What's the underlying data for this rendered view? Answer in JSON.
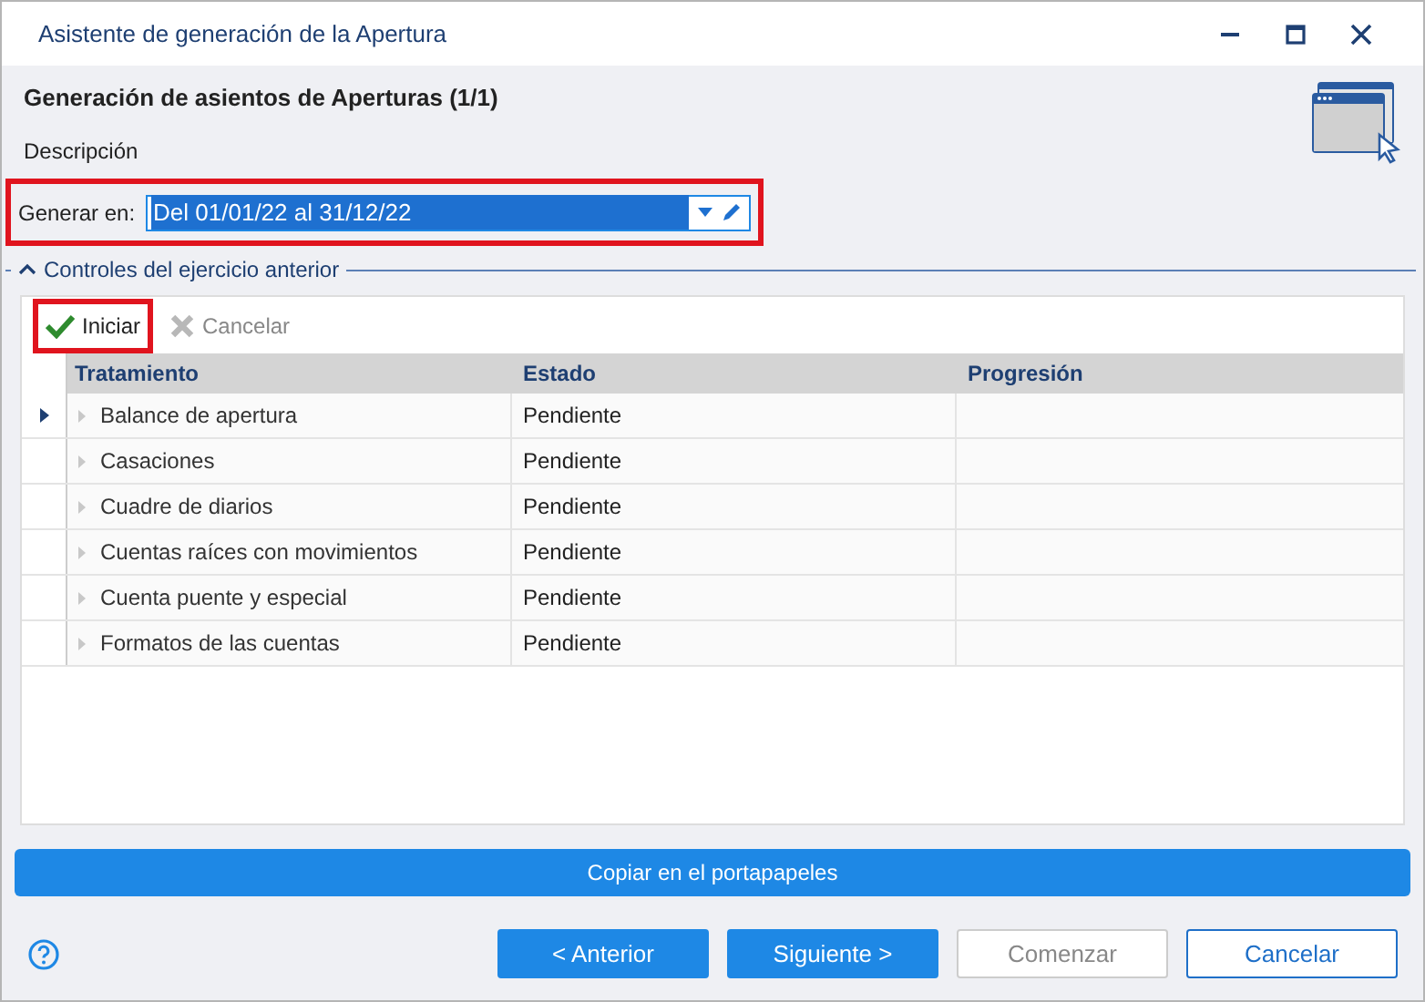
{
  "window": {
    "title": "Asistente de generación de la Apertura"
  },
  "header": {
    "title": "Generación de asientos de Aperturas (1/1)",
    "subtitle": "Descripción"
  },
  "generate_field": {
    "label": "Generar en:",
    "value": "Del 01/01/22 al 31/12/22",
    "highlighted": true
  },
  "group": {
    "title": "Controles del ejercicio anterior",
    "expanded": true
  },
  "toolbar": [
    {
      "label": "Iniciar",
      "kind": "start",
      "disabled": false,
      "highlighted": true
    },
    {
      "label": "Cancelar",
      "kind": "cancel",
      "disabled": true,
      "highlighted": false
    }
  ],
  "table": {
    "columns": [
      "Tratamiento",
      "Estado",
      "Progresión"
    ],
    "rows": [
      {
        "name": "Balance de apertura",
        "status": "Pendiente",
        "selected": true
      },
      {
        "name": "Casaciones",
        "status": "Pendiente",
        "selected": false
      },
      {
        "name": "Cuadre de diarios",
        "status": "Pendiente",
        "selected": false
      },
      {
        "name": "Cuentas raíces con movimientos",
        "status": "Pendiente",
        "selected": false
      },
      {
        "name": "Cuenta puente y especial",
        "status": "Pendiente",
        "selected": false
      },
      {
        "name": "Formatos de las cuentas",
        "status": "Pendiente",
        "selected": false
      }
    ]
  },
  "copy_button": "Copiar en el portapapeles",
  "buttons": [
    {
      "label": "< Anterior",
      "kind": "primary"
    },
    {
      "label": "Siguiente >",
      "kind": "primary"
    },
    {
      "label": "Comenzar",
      "kind": "disabled"
    },
    {
      "label": "Cancelar",
      "kind": "outline"
    }
  ]
}
